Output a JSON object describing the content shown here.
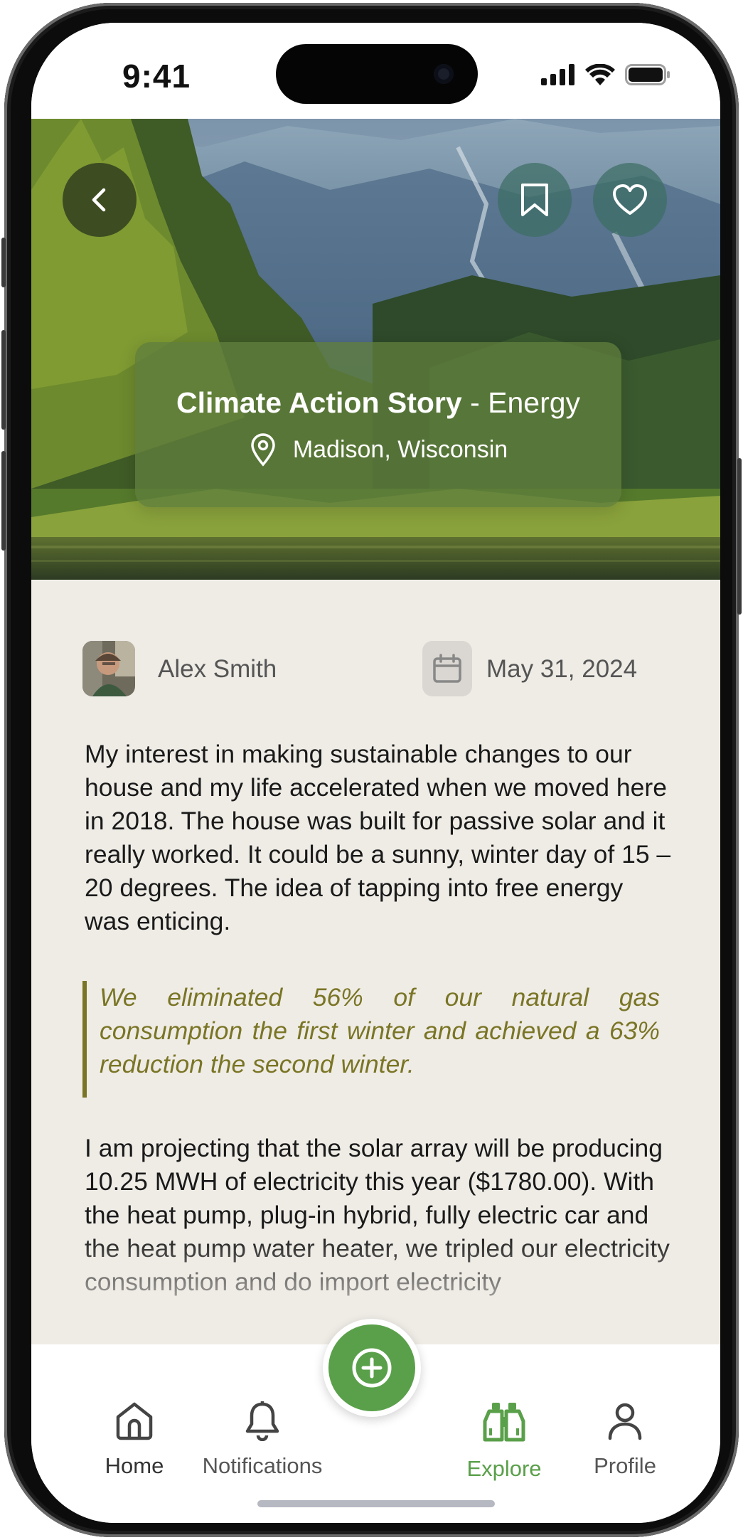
{
  "status_bar": {
    "time": "9:41",
    "icons": [
      "signal-icon",
      "wifi-icon",
      "battery-icon"
    ]
  },
  "hero": {
    "title_bold": "Climate Action Story",
    "title_rest": " - Energy",
    "location": "Madison, Wisconsin",
    "buttons": [
      "back-icon",
      "bookmark-icon",
      "heart-icon"
    ]
  },
  "story": {
    "author": "Alex Smith",
    "date": "May 31, 2024",
    "paragraph1": "My interest in making sustainable changes to our house and my life accelerated when we moved here in 2018. The house was built for passive solar and it really worked. It could be a sunny, winter day of 15 – 20 degrees. The idea of tapping into free energy was enticing.",
    "quote": "We eliminated 56% of our natural gas consumption the first winter and achieved a 63% reduction the second winter.",
    "paragraph2": "I am projecting that the solar array will be producing 10.25 MWH of electricity this year ($1780.00).  With the heat pump, plug-in hybrid, fully electric car and the heat pump water heater, we tripled our electricity consumption and do import electricity"
  },
  "tabbar": {
    "home": "Home",
    "notifications": "Notifications",
    "explore": "Explore",
    "profile": "Profile",
    "active": "Explore"
  },
  "colors": {
    "accent_green": "#5aa04a",
    "quote_olive": "#7a7525",
    "background": "#efece6"
  }
}
